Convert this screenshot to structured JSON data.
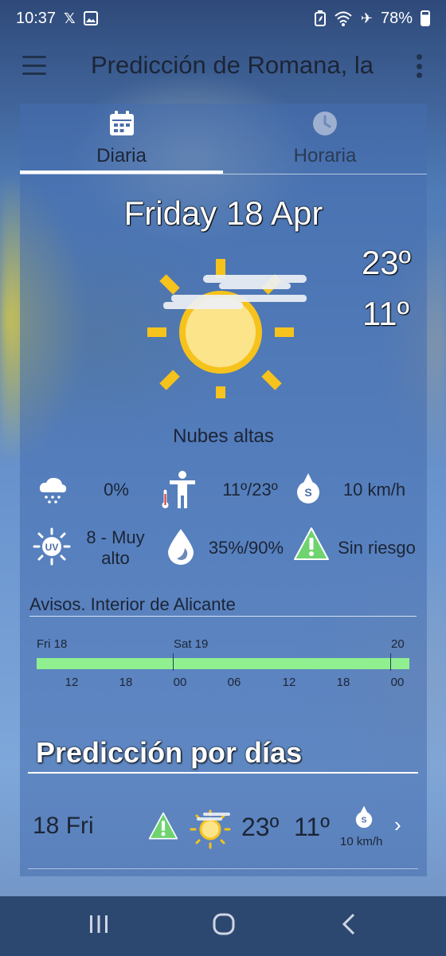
{
  "status_bar": {
    "time": "10:37",
    "battery": "78%",
    "icons": [
      "x-icon",
      "image-icon",
      "battery-saver-icon",
      "wifi-icon",
      "airplane-icon",
      "battery-icon"
    ]
  },
  "app_bar": {
    "title": "Predicción de Romana, la"
  },
  "tabs": [
    {
      "label": "Diaria",
      "icon": "calendar-icon",
      "selected": true
    },
    {
      "label": "Horaria",
      "icon": "clock-icon",
      "selected": false
    }
  ],
  "today": {
    "date": "Friday 18 Apr",
    "max": "23º",
    "min": "11º",
    "condition": "Nubes altas",
    "rain": "0%",
    "feels": "11º/23º",
    "wind": "10 km/h",
    "wind_dir": "S",
    "uv_line1": "8 - Muy",
    "uv_line2": "alto",
    "uv_badge": "UV",
    "humidity": "35%/90%",
    "risk": "Sin riesgo"
  },
  "avisos": {
    "title": "Avisos. Interior de Alicante",
    "days": [
      "Fri 18",
      "Sat 19",
      "20"
    ],
    "hours": [
      "12",
      "18",
      "00",
      "06",
      "12",
      "18",
      "00"
    ],
    "level_color": "#90f090"
  },
  "forecast": {
    "title": "Predicción por días",
    "rows": [
      {
        "day": "18 Fri",
        "max": "23º",
        "min": "11º",
        "wind": "10 km/h",
        "wind_dir": "S"
      }
    ]
  },
  "colors": {
    "sun": "#f6c21c",
    "sun_fill": "#fbe48a",
    "warning_green": "#6fd36f",
    "nav_bg": "#2d4870"
  }
}
